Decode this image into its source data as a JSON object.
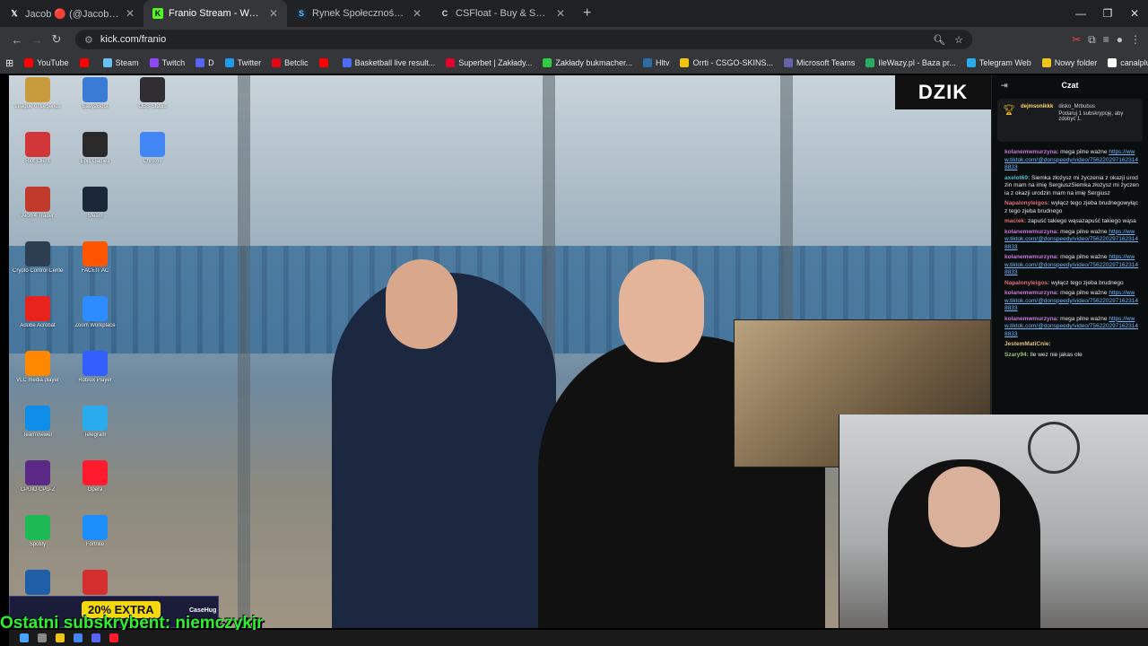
{
  "browser": {
    "tabs": [
      {
        "label": "Jacob 🔴 (@Jacob4yt) / X",
        "icon": "x-icon",
        "color": "#ffffff"
      },
      {
        "label": "Franio Stream - Watch Live",
        "icon": "kick-icon",
        "color": "#53fc18"
      },
      {
        "label": "Rynek Społeczności Steam :: Of",
        "icon": "steam-icon",
        "color": "#66c0f4"
      },
      {
        "label": "CSFloat - Buy & Sell CS2 Skins",
        "icon": "csfloat-icon",
        "color": "#dddddd"
      }
    ],
    "url": "kick.com/franio",
    "bookmarks": [
      {
        "label": "YouTube",
        "color": "#ff0000"
      },
      {
        "label": "",
        "color": "#ff0000"
      },
      {
        "label": "Steam",
        "color": "#66c0f4"
      },
      {
        "label": "Twitch",
        "color": "#9146ff"
      },
      {
        "label": "D",
        "color": "#5865f2"
      },
      {
        "label": "Twitter",
        "color": "#1d9bf0"
      },
      {
        "label": "Betclic",
        "color": "#e30613"
      },
      {
        "label": "",
        "color": "#ff0000"
      },
      {
        "label": "Basketball live result...",
        "color": "#4a6cf7"
      },
      {
        "label": "Superbet | Zakłady...",
        "color": "#e4002b"
      },
      {
        "label": "Zakłady bukmacher...",
        "color": "#2ecc40"
      },
      {
        "label": "Hltv",
        "color": "#2d6da3"
      },
      {
        "label": "Orrti - CSGO-SKINS...",
        "color": "#f1c40f"
      },
      {
        "label": "Microsoft Teams",
        "color": "#6264a7"
      },
      {
        "label": "IleWazy.pl - Baza pr...",
        "color": "#27ae60"
      },
      {
        "label": "Telegram Web",
        "color": "#2aabee"
      },
      {
        "label": "Nowy folder",
        "color": "#f0c419"
      },
      {
        "label": "canalplus.com",
        "color": "#ffffff"
      }
    ]
  },
  "stream": {
    "brand_logo": "DZIK",
    "promo_text": "20% EXTRA",
    "promo_brand": "CaseHug",
    "subscriber_overlay": "Ostatni subskrybent: niemczykjr",
    "desktop_icons": [
      {
        "label": "League of Legends",
        "color": "#c89b3c"
      },
      {
        "label": "Riot Client",
        "color": "#d13639"
      },
      {
        "label": "Aion 4 Trader",
        "color": "#c0392b"
      },
      {
        "label": "Crypto Control Center",
        "color": "#2c3e50"
      },
      {
        "label": "Adobe Acrobat",
        "color": "#e8221c"
      },
      {
        "label": "VLC media player",
        "color": "#ff8800"
      },
      {
        "label": "TeamViewer",
        "color": "#0e8ee9"
      },
      {
        "label": "CPUID CPU-Z",
        "color": "#5b2a86"
      },
      {
        "label": "Spotify",
        "color": "#1db954"
      },
      {
        "label": "Unreal Engine",
        "color": "#1f5fa8"
      },
      {
        "label": "EA",
        "color": "#ff4747"
      },
      {
        "label": "Easy2Boot",
        "color": "#3a7bd5"
      },
      {
        "label": "Epic Games",
        "color": "#2a2a2a"
      },
      {
        "label": "Steam",
        "color": "#1b2838"
      },
      {
        "label": "FACEIT AC",
        "color": "#ff5500"
      },
      {
        "label": "Zoom Workplace",
        "color": "#2d8cff"
      },
      {
        "label": "Roblox Player",
        "color": "#335fff"
      },
      {
        "label": "Telegram",
        "color": "#2aabee"
      },
      {
        "label": "Opera",
        "color": "#ff1b2d"
      },
      {
        "label": "Fortnite",
        "color": "#1c8ef9"
      },
      {
        "label": "CPUID HWMonitor",
        "color": "#d32f2f"
      },
      {
        "label": "Stream Deck",
        "color": "#2b2d42"
      },
      {
        "label": "OBS Studio",
        "color": "#302e31"
      },
      {
        "label": "Chrome",
        "color": "#4285f4"
      }
    ]
  },
  "chat": {
    "title": "Czat",
    "pinned": {
      "user": "dejmsonikkk",
      "gift_from": "disko_Mrbubus",
      "text": "Podaruj 1 subskrypcję, aby zdobyć 1."
    },
    "messages": [
      {
        "user": "kolanemwmurzyna:",
        "color": "#c678dd",
        "text": "mega pilne ważne",
        "link": "https://www.tiktok.com/@donspeedy/video/7562202971623148833"
      },
      {
        "user": "axelot69:",
        "color": "#56b6c2",
        "text": "Siemka złożysz mi życzenia z okazji urodzin mam na imię SergiuszSiemka złożysz mi życzenia z okazji urodzin mam na imię Sergiusz",
        "link": ""
      },
      {
        "user": "Napalonyleigos:",
        "color": "#e06c75",
        "text": "wyłącz tego zjeba brudnegowyłącz tego zjeba brudnego",
        "link": ""
      },
      {
        "user": "maciek:",
        "color": "#e06c75",
        "text": "zapuść takiego wąsazapuść takiego wąsa",
        "link": ""
      },
      {
        "user": "kolanemwmurzyna:",
        "color": "#c678dd",
        "text": "mega pilne ważne",
        "link": "https://www.tiktok.com/@donspeedy/video/7562202971623148833"
      },
      {
        "user": "kolanemwmurzyna:",
        "color": "#c678dd",
        "text": "mega pilne ważne",
        "link": "https://www.tiktok.com/@donspeedy/video/7562202971623148833"
      },
      {
        "user": "Napalonyleigos:",
        "color": "#e06c75",
        "text": "wyłącz tego zjeba brudnego",
        "link": ""
      },
      {
        "user": "kolanemwmurzyna:",
        "color": "#c678dd",
        "text": "mega pilne ważne",
        "link": "https://www.tiktok.com/@donspeedy/video/7562202971623148833"
      },
      {
        "user": "kolanemwmurzyna:",
        "color": "#c678dd",
        "text": "mega pilne ważne",
        "link": "https://www.tiktok.com/@donspeedy/video/7562202971623148833"
      },
      {
        "user": "JestemMatiCnie:",
        "color": "#e5c07b",
        "text": "",
        "link": ""
      },
      {
        "user": "Szary94:",
        "color": "#98c379",
        "text": "Ile wez nie jakas ole",
        "link": ""
      }
    ]
  }
}
